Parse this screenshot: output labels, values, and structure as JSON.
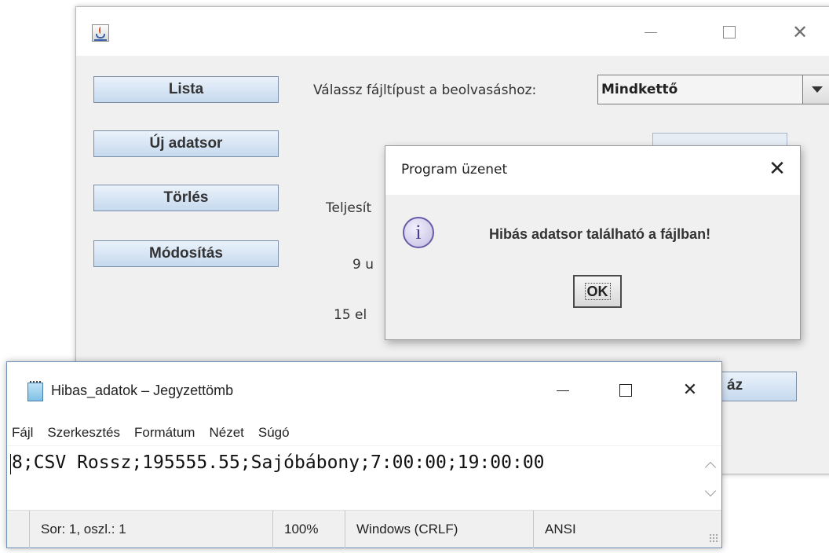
{
  "java_window": {
    "buttons": {
      "lista": "Lista",
      "uj_adatsor": "Új adatsor",
      "torles": "Törlés",
      "modositas": "Módosítás"
    },
    "filetype_label": "Válassz fájltípust a beolvasáshoz:",
    "filetype_selected": "Mindkettő",
    "partial_labels": {
      "teljesit": "Teljesít",
      "nine": "9 u",
      "fifteen": "15 el"
    },
    "partial_button": "áz"
  },
  "dialog": {
    "title": "Program üzenet",
    "message": "Hibás adatsor található a fájlban!",
    "ok": "OK",
    "close": "✕"
  },
  "notepad": {
    "title": "Hibas_adatok – Jegyzettömb",
    "menu": [
      "Fájl",
      "Szerkesztés",
      "Formátum",
      "Nézet",
      "Súgó"
    ],
    "content": "8;CSV Rossz;195555.55;Sajóbábony;7:00:00;19:00:00",
    "status": {
      "position": "Sor: 1, oszl.: 1",
      "zoom": "100%",
      "line_ending": "Windows (CRLF)",
      "encoding": "ANSI"
    },
    "close": "✕"
  },
  "icons": {
    "java_window": "java-cup-icon",
    "dialog": "info-icon",
    "notepad": "notepad-icon"
  },
  "colors": {
    "button_top": "#eaf2fb",
    "button_bottom": "#c6d9ee",
    "info_icon": "#6a5aa8"
  }
}
